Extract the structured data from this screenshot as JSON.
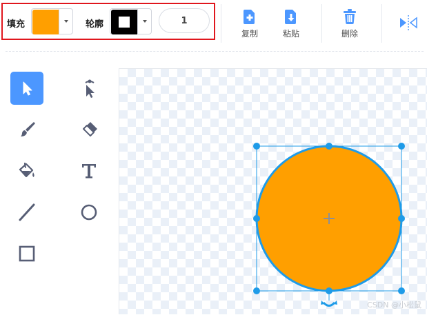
{
  "toolbar": {
    "fill_label": "填充",
    "outline_label": "轮廓",
    "outline_width": "1",
    "copy_label": "复制",
    "paste_label": "粘贴",
    "delete_label": "删除"
  },
  "colors": {
    "fill": "#ff9f00",
    "outline_swatch": "#000000",
    "highlight_border": "#e0161d",
    "selection": "#1e9be8",
    "accent": "#4c97ff"
  },
  "tools": [
    {
      "name": "select",
      "icon": "arrow-cursor-icon",
      "active": true
    },
    {
      "name": "reshape",
      "icon": "reshape-cursor-icon",
      "active": false
    },
    {
      "name": "brush",
      "icon": "brush-icon",
      "active": false
    },
    {
      "name": "eraser",
      "icon": "eraser-icon",
      "active": false
    },
    {
      "name": "fill",
      "icon": "paint-bucket-icon",
      "active": false
    },
    {
      "name": "text",
      "icon": "text-icon",
      "active": false
    },
    {
      "name": "line",
      "icon": "line-icon",
      "active": false
    },
    {
      "name": "circle",
      "icon": "circle-icon",
      "active": false
    },
    {
      "name": "rectangle",
      "icon": "rectangle-icon",
      "active": false
    }
  ],
  "canvas": {
    "shape": "circle",
    "selected": true
  },
  "watermark": "CSDN @小松鼠"
}
